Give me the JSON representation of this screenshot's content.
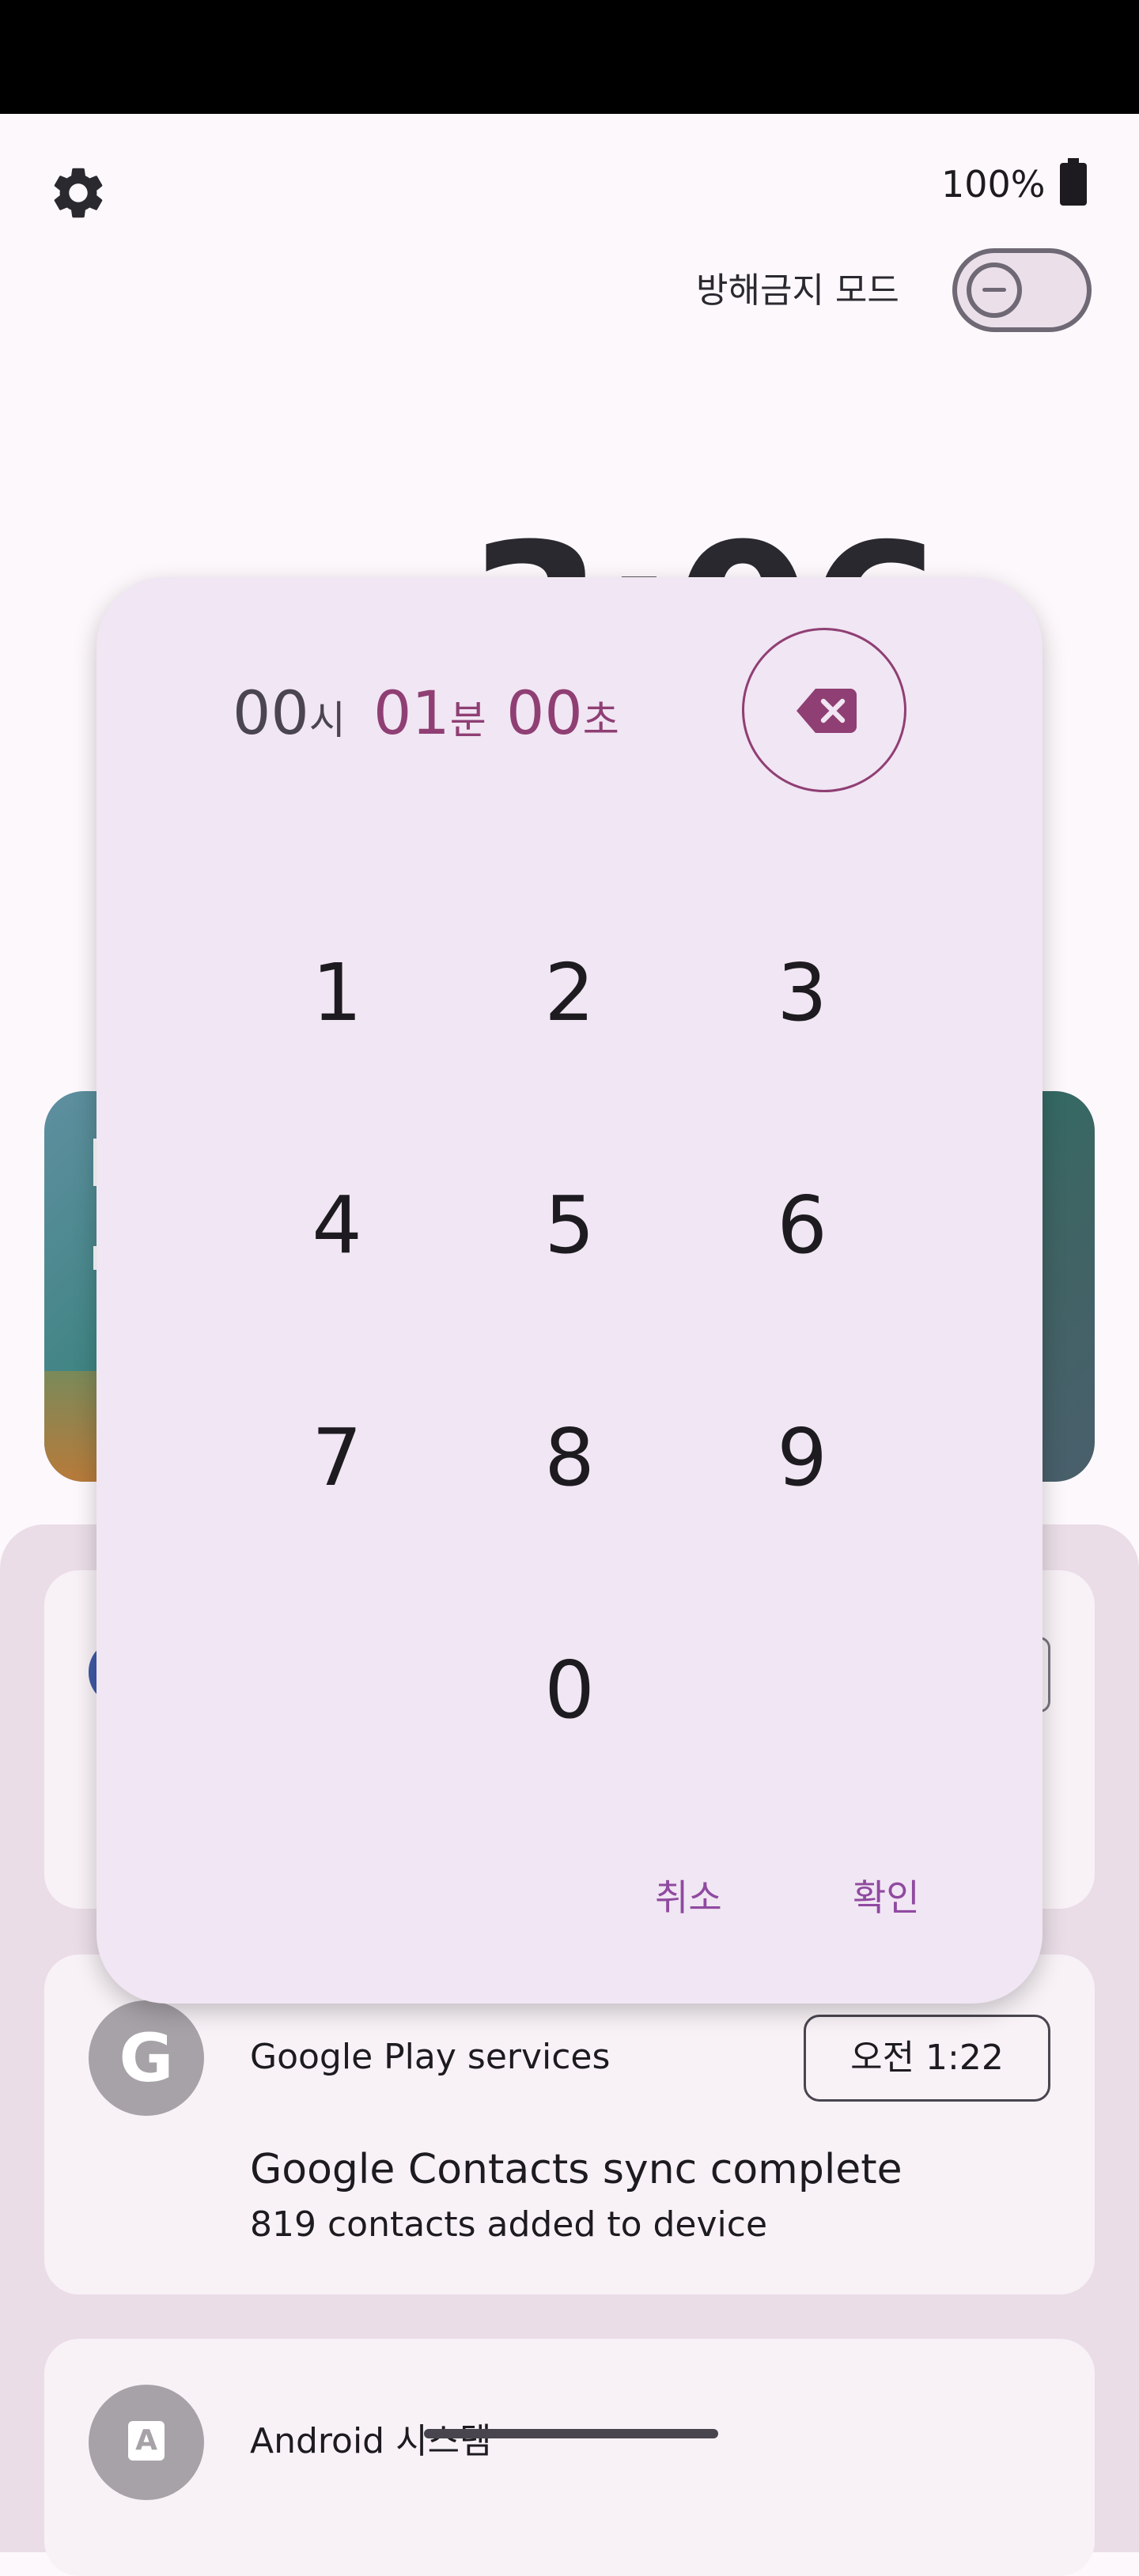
{
  "status_bar": {
    "battery_percent": "100%",
    "battery_level": 1.0
  },
  "header": {
    "settings_icon": "gear-icon",
    "dnd_label": "방해금지 모드",
    "dnd_enabled": false
  },
  "clock": {
    "visible_fragment": "3:06"
  },
  "timer_dialog": {
    "hours_value": "00",
    "hours_unit": "시",
    "minutes_value": "01",
    "minutes_unit": "분",
    "seconds_value": "00",
    "seconds_unit": "초",
    "backspace_icon": "backspace-icon",
    "keys": [
      "1",
      "2",
      "3",
      "4",
      "5",
      "6",
      "7",
      "8",
      "9",
      "0"
    ],
    "cancel_label": "취소",
    "ok_label": "확인"
  },
  "notifications": [
    {
      "app_name": "Google Play services",
      "avatar_letter": "G",
      "time": "오전 1:22",
      "title": "Google Contacts sync complete",
      "body": "819 contacts added to device"
    },
    {
      "app_name": "Android 시스템",
      "avatar_letter": "A"
    }
  ],
  "colors": {
    "accent": "#8f3f74",
    "action_text": "#8f4aa0",
    "dialog_bg": "#f1e6f3",
    "panel_bg": "#eadde7"
  }
}
